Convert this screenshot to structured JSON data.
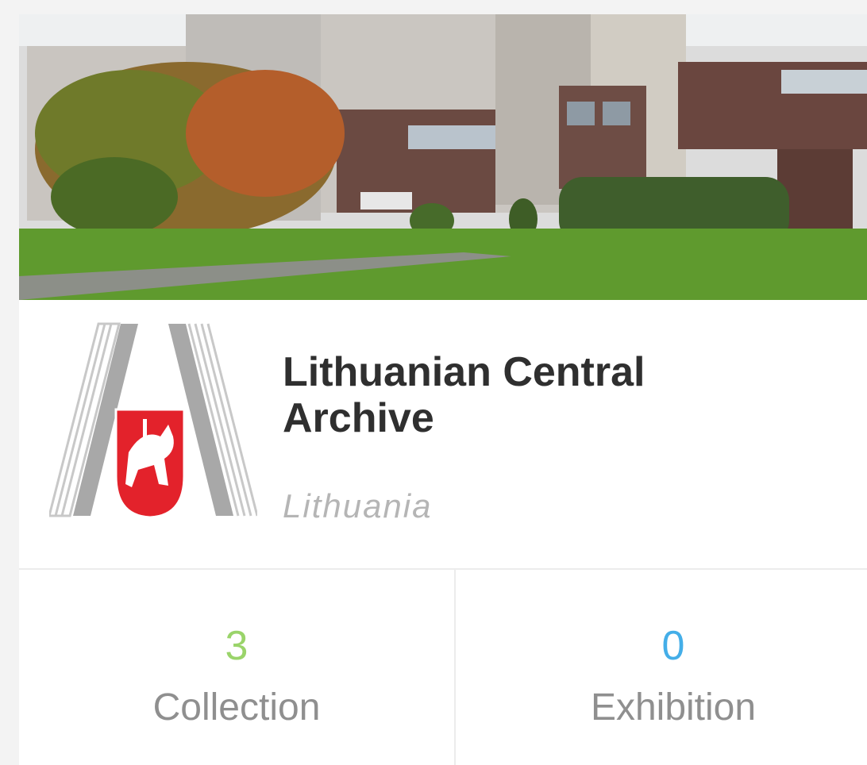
{
  "institution": {
    "name": "Lithuanian Central Archive",
    "country": "Lithuania"
  },
  "stats": [
    {
      "value": "3",
      "label": "Collection",
      "color": "#9ad46a"
    },
    {
      "value": "0",
      "label": "Exhibition",
      "color": "#44aee8"
    }
  ],
  "colors": {
    "title": "#2f2f2f",
    "country": "#b5b5b5",
    "stat_label": "#8f8f8f",
    "logo_grey": "#a8a8a8",
    "shield_red": "#e3222b"
  },
  "icons": {
    "logo": "archive-logo-icon",
    "coat_of_arms": "vytis-shield-icon"
  }
}
